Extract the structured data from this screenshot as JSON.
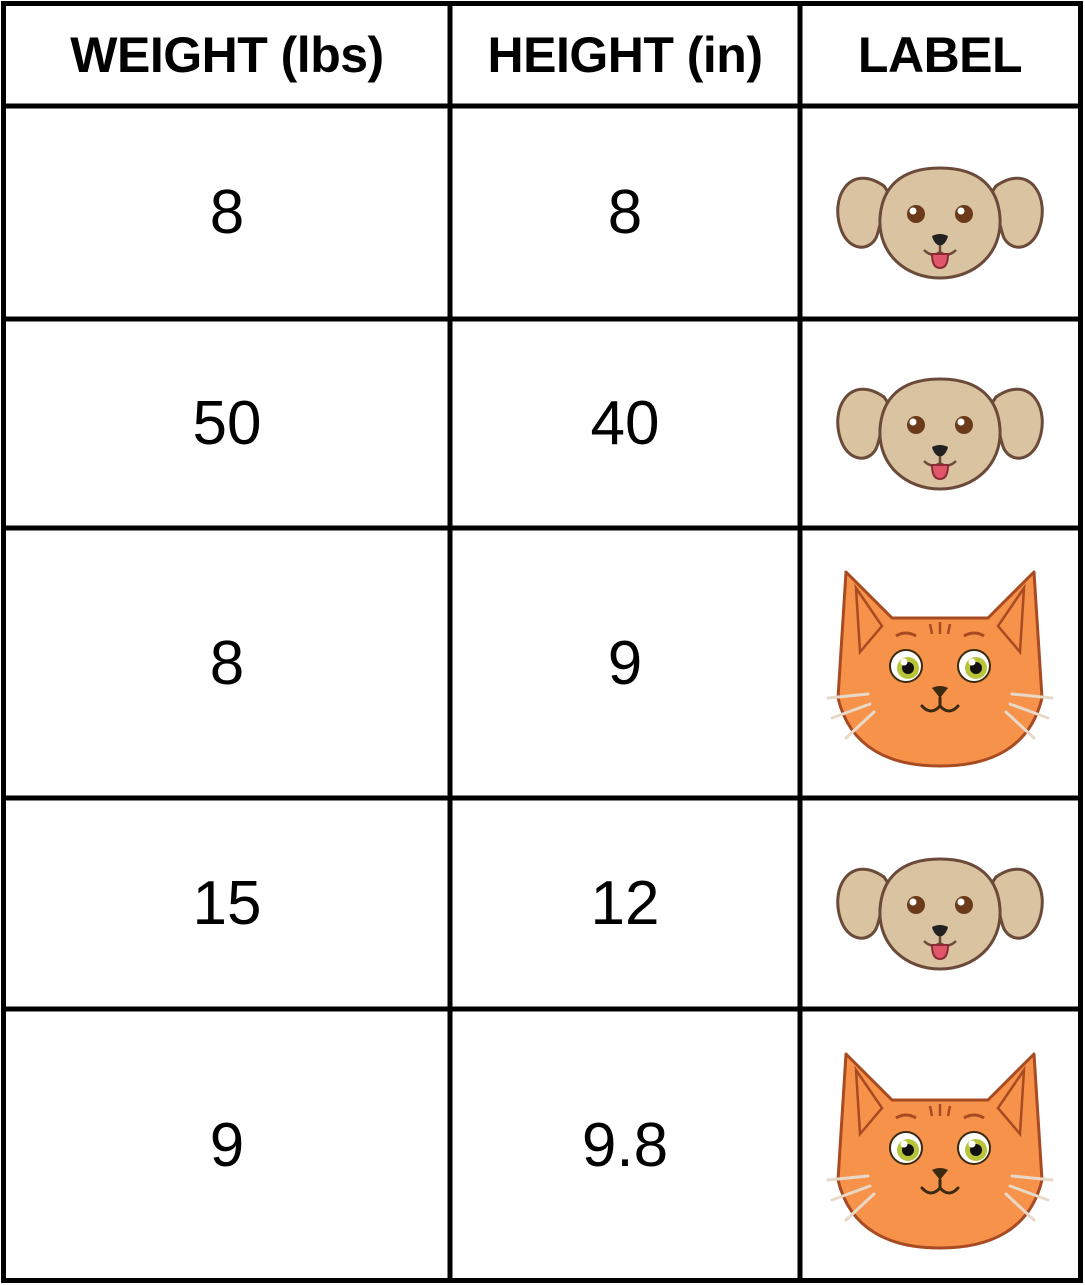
{
  "table": {
    "headers": [
      "WEIGHT (lbs)",
      "HEIGHT (in)",
      "LABEL"
    ],
    "rows": [
      {
        "weight": "8",
        "height": "8",
        "label_icon": "dog-face-icon"
      },
      {
        "weight": "50",
        "height": "40",
        "label_icon": "dog-face-icon"
      },
      {
        "weight": "8",
        "height": "9",
        "label_icon": "cat-face-icon"
      },
      {
        "weight": "15",
        "height": "12",
        "label_icon": "dog-face-icon"
      },
      {
        "weight": "9",
        "height": "9.8",
        "label_icon": "cat-face-icon"
      }
    ]
  },
  "colors": {
    "border": "#000000",
    "dog_fur": "#d9c3a0",
    "dog_outline": "#6b4a3a",
    "cat_fur": "#f7924a",
    "cat_outline": "#a84b22"
  }
}
